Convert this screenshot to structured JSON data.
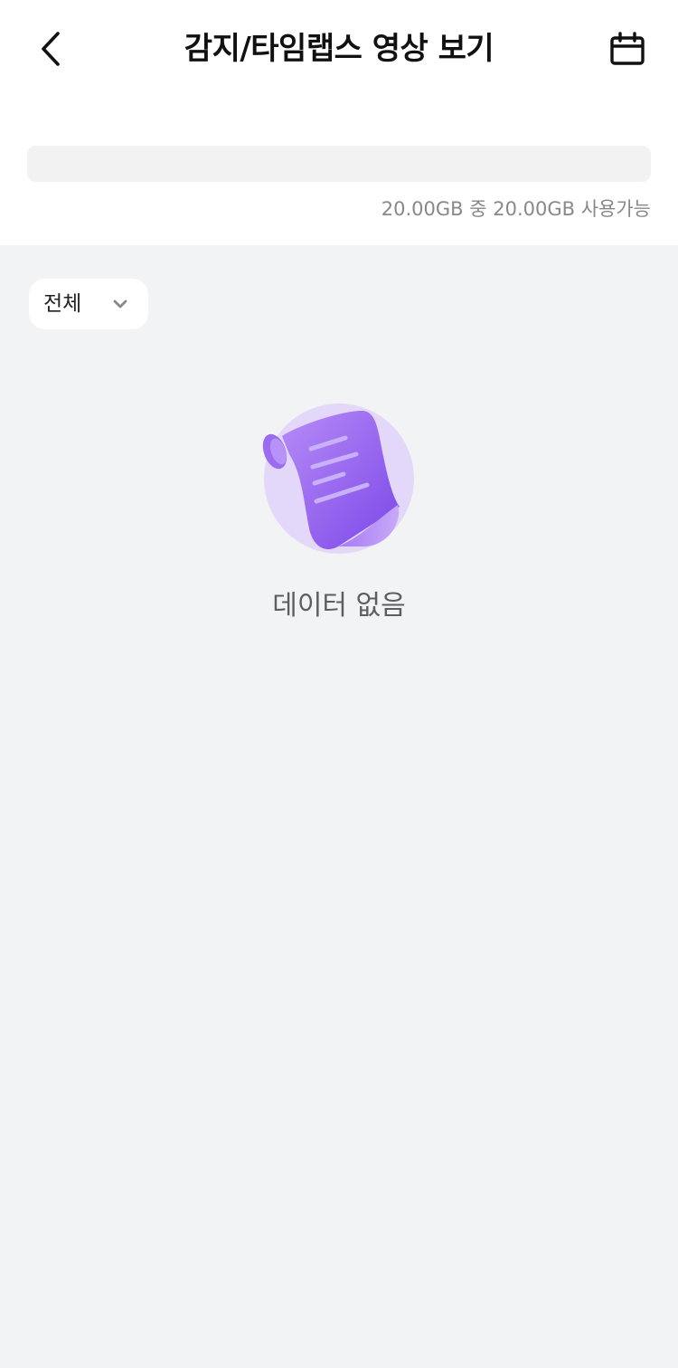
{
  "header": {
    "title": "감지/타임랩스 영상 보기",
    "back_icon": "chevron-left-icon",
    "calendar_icon": "calendar-icon"
  },
  "storage": {
    "text": "20.00GB 중 20.00GB 사용가능",
    "used_fraction": 0
  },
  "filter": {
    "selected": "전체",
    "icon": "chevron-down-icon"
  },
  "empty_state": {
    "icon": "scroll-document-icon",
    "message": "데이터 없음"
  },
  "colors": {
    "accent": "#8B5CF6",
    "accent_light": "#E3D8F9",
    "background": "#F2F3F5"
  }
}
